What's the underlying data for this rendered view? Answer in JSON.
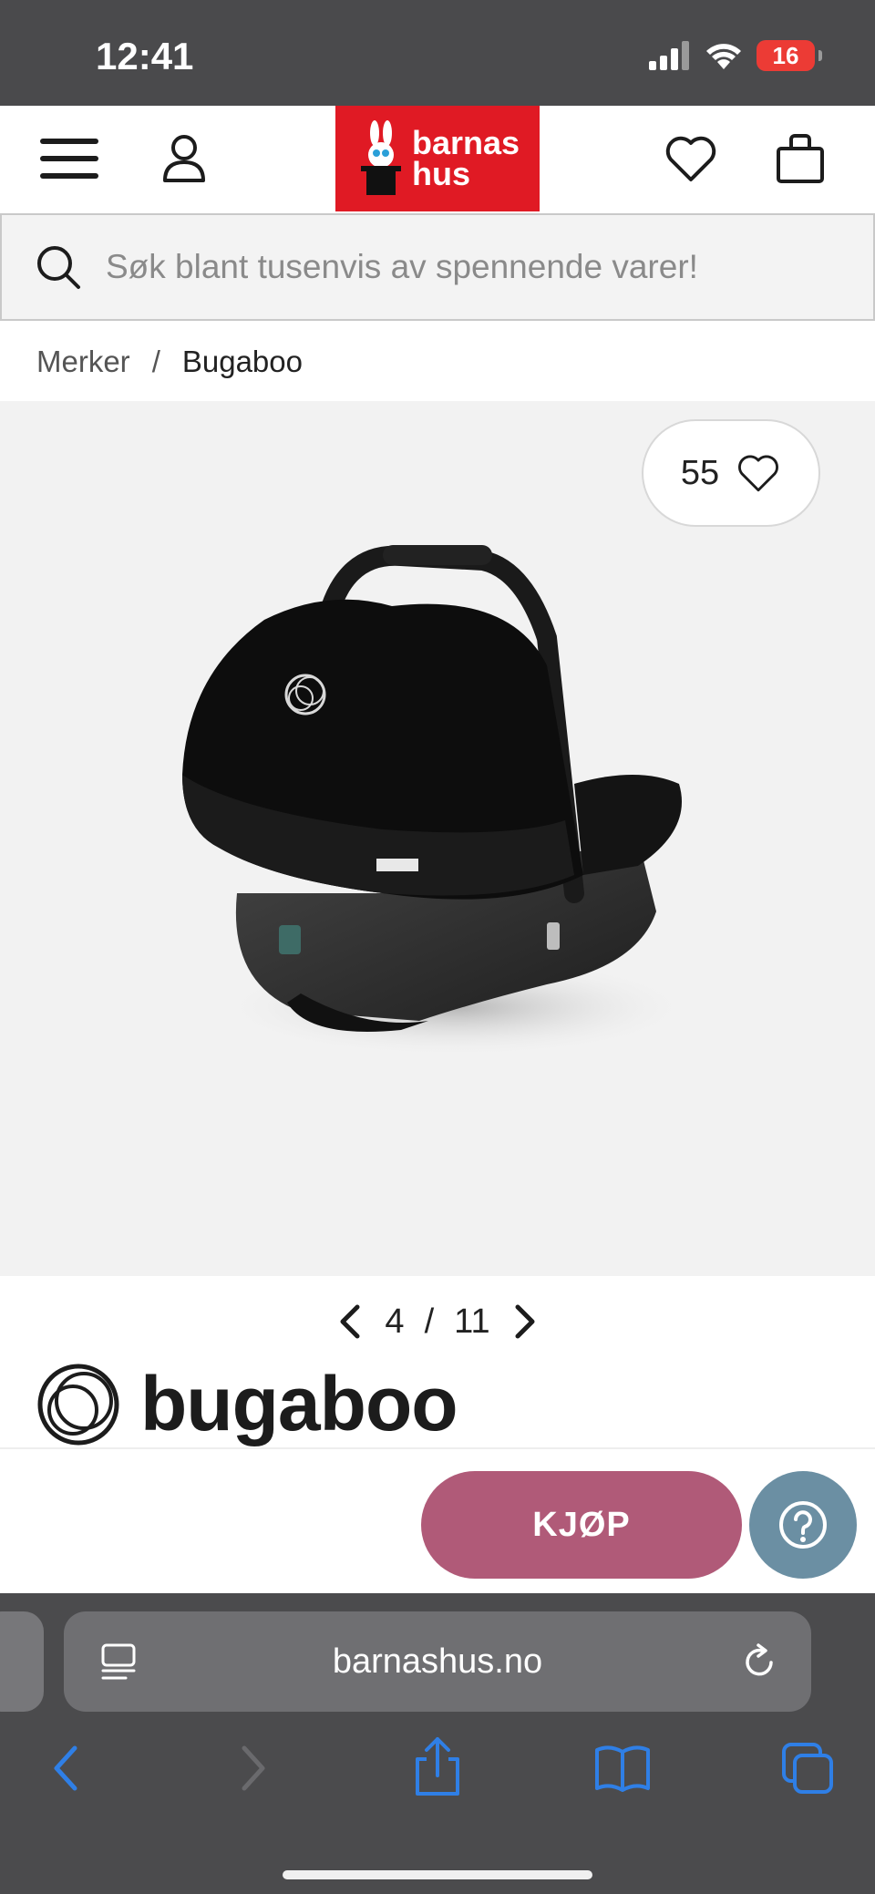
{
  "status_bar": {
    "time": "12:41",
    "battery": "16"
  },
  "header": {
    "logo_line1": "barnas",
    "logo_line2": "hus"
  },
  "search": {
    "placeholder": "Søk blant tusenvis av spennende varer!"
  },
  "breadcrumb": {
    "parent": "Merker",
    "separator": "/",
    "current": "Bugaboo"
  },
  "product": {
    "favorite_count": "55"
  },
  "pager": {
    "current": "4",
    "separator": "/",
    "total": "11"
  },
  "brand": {
    "name": "bugaboo"
  },
  "buy_bar": {
    "buy_label": "KJØP",
    "help_label": "?"
  },
  "browser": {
    "url": "barnashus.no"
  },
  "colors": {
    "brand_red": "#e01a24",
    "buy_button": "#b05a78",
    "help_button": "#6b8fa3",
    "safari_blue": "#2f7fe6"
  }
}
